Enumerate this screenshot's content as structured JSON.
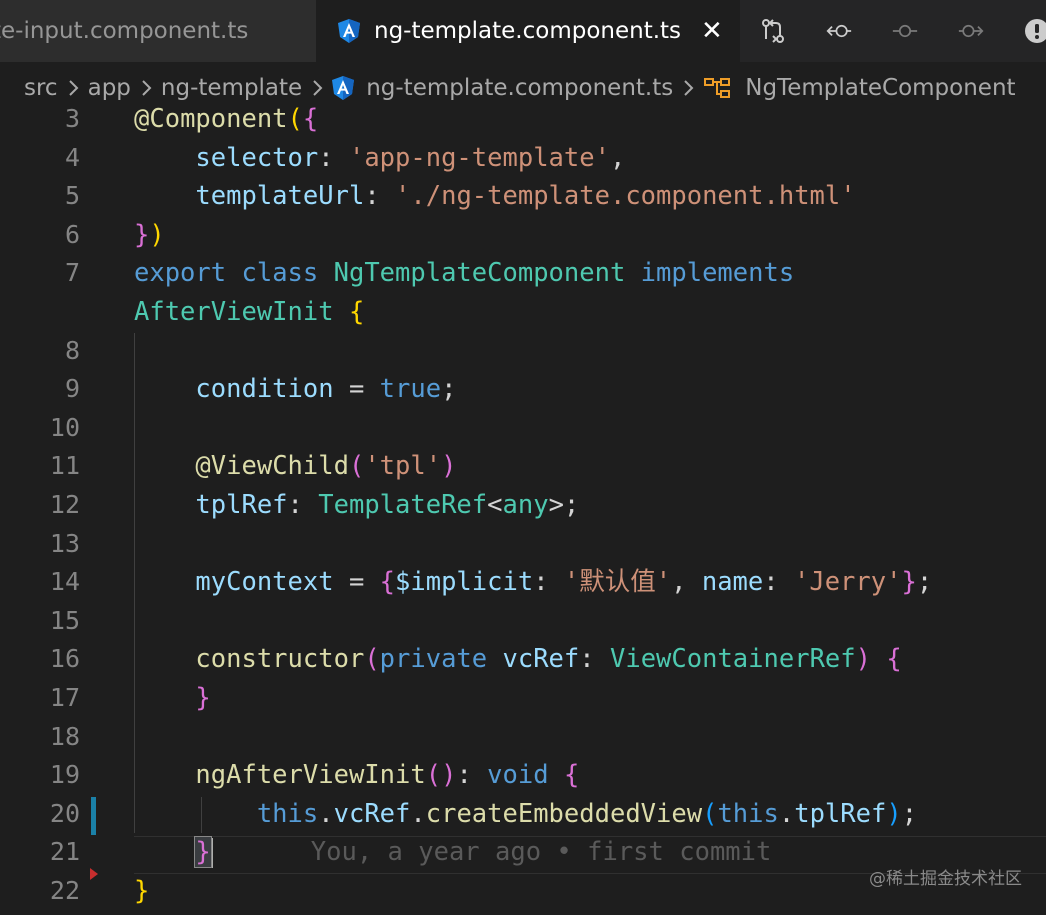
{
  "colors": {
    "editor_bg": "#1e1e1e",
    "tabbar_bg": "#252526",
    "angular_icon": "#1e88e5",
    "symbol_icon": "#ee9d28",
    "git_modified": "#1b81a8",
    "git_deleted": "#c72e2e"
  },
  "tabs": [
    {
      "label": "te-input.component.ts",
      "active": false,
      "icon": null
    },
    {
      "label": "ng-template.component.ts",
      "active": true,
      "icon": "angular-icon",
      "close_icon": "close-icon",
      "close_glyph": "✕"
    }
  ],
  "toolbar": {
    "icons": [
      "git-compare-icon",
      "go-back-icon",
      "git-commit-icon",
      "go-forward-icon",
      "account-icon"
    ]
  },
  "breadcrumbs": [
    {
      "label": "src",
      "icon": null
    },
    {
      "label": "app",
      "icon": null
    },
    {
      "label": "ng-template",
      "icon": null
    },
    {
      "label": "ng-template.component.ts",
      "icon": "angular-icon"
    },
    {
      "label": "NgTemplateComponent",
      "icon": "class-symbol-icon"
    }
  ],
  "editor": {
    "line_numbers": [
      "3",
      "4",
      "5",
      "6",
      "7",
      "",
      "8",
      "9",
      "10",
      "11",
      "12",
      "13",
      "14",
      "15",
      "16",
      "17",
      "18",
      "19",
      "20",
      "21",
      "22"
    ],
    "lines": [
      [
        [
          "dec",
          "@"
        ],
        [
          "fn",
          "Component"
        ],
        [
          "b1",
          "("
        ],
        [
          "b2",
          "{"
        ]
      ],
      [
        [
          "punc",
          "    "
        ],
        [
          "prop",
          "selector"
        ],
        [
          "punc",
          ": "
        ],
        [
          "str",
          "'app-ng-template'"
        ],
        [
          "punc",
          ","
        ]
      ],
      [
        [
          "punc",
          "    "
        ],
        [
          "prop",
          "templateUrl"
        ],
        [
          "punc",
          ": "
        ],
        [
          "str",
          "'./ng-template.component.html'"
        ]
      ],
      [
        [
          "b2",
          "}"
        ],
        [
          "b1",
          ")"
        ]
      ],
      [
        [
          "kw",
          "export"
        ],
        [
          "punc",
          " "
        ],
        [
          "kw",
          "class"
        ],
        [
          "punc",
          " "
        ],
        [
          "type",
          "NgTemplateComponent"
        ],
        [
          "punc",
          " "
        ],
        [
          "kw",
          "implements"
        ]
      ],
      [
        [
          "type",
          "AfterViewInit"
        ],
        [
          "punc",
          " "
        ],
        [
          "b1",
          "{"
        ]
      ],
      [],
      [
        [
          "punc",
          "    "
        ],
        [
          "prop",
          "condition"
        ],
        [
          "punc",
          " = "
        ],
        [
          "kw",
          "true"
        ],
        [
          "punc",
          ";"
        ]
      ],
      [],
      [
        [
          "punc",
          "    "
        ],
        [
          "dec",
          "@"
        ],
        [
          "fn",
          "ViewChild"
        ],
        [
          "b2",
          "("
        ],
        [
          "str",
          "'tpl'"
        ],
        [
          "b2",
          ")"
        ]
      ],
      [
        [
          "punc",
          "    "
        ],
        [
          "prop",
          "tplRef"
        ],
        [
          "punc",
          ": "
        ],
        [
          "type",
          "TemplateRef"
        ],
        [
          "punc",
          "<"
        ],
        [
          "type",
          "any"
        ],
        [
          "punc",
          ">;"
        ]
      ],
      [],
      [
        [
          "punc",
          "    "
        ],
        [
          "prop",
          "myContext"
        ],
        [
          "punc",
          " = "
        ],
        [
          "b2",
          "{"
        ],
        [
          "prop",
          "$implicit"
        ],
        [
          "punc",
          ": "
        ],
        [
          "str",
          "'默认值'"
        ],
        [
          "punc",
          ", "
        ],
        [
          "prop",
          "name"
        ],
        [
          "punc",
          ": "
        ],
        [
          "str",
          "'Jerry'"
        ],
        [
          "b2",
          "}"
        ],
        [
          "punc",
          ";"
        ]
      ],
      [],
      [
        [
          "punc",
          "    "
        ],
        [
          "fn",
          "constructor"
        ],
        [
          "b2",
          "("
        ],
        [
          "kw",
          "private"
        ],
        [
          "punc",
          " "
        ],
        [
          "prop",
          "vcRef"
        ],
        [
          "punc",
          ": "
        ],
        [
          "type",
          "ViewContainerRef"
        ],
        [
          "b2",
          ")"
        ],
        [
          "punc",
          " "
        ],
        [
          "b2",
          "{"
        ]
      ],
      [
        [
          "punc",
          "    "
        ],
        [
          "b2",
          "}"
        ]
      ],
      [],
      [
        [
          "punc",
          "    "
        ],
        [
          "fn",
          "ngAfterViewInit"
        ],
        [
          "b2",
          "()"
        ],
        [
          "punc",
          ": "
        ],
        [
          "kw",
          "void"
        ],
        [
          "punc",
          " "
        ],
        [
          "b2",
          "{"
        ]
      ],
      [
        [
          "punc",
          "        "
        ],
        [
          "kw",
          "this"
        ],
        [
          "punc",
          "."
        ],
        [
          "prop",
          "vcRef"
        ],
        [
          "punc",
          "."
        ],
        [
          "fn",
          "createEmbeddedView"
        ],
        [
          "b3",
          "("
        ],
        [
          "kw",
          "this"
        ],
        [
          "punc",
          "."
        ],
        [
          "prop",
          "tplRef"
        ],
        [
          "b3",
          ")"
        ],
        [
          "punc",
          ";"
        ]
      ],
      [
        [
          "punc",
          "    "
        ],
        [
          "b2",
          "}"
        ]
      ],
      [
        [
          "b1",
          "}"
        ]
      ]
    ],
    "blame": "You, a year ago • first commit"
  },
  "watermark": "@稀土掘金技术社区"
}
